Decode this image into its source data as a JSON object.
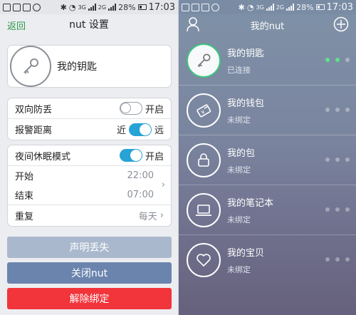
{
  "left": {
    "status": {
      "battery": "28%",
      "time": "17:03",
      "net1": "3G",
      "net2": "2G"
    },
    "header": {
      "back": "返回",
      "title": "nut 设置"
    },
    "key": {
      "name": "我的钥匙",
      "icon": "key-icon"
    },
    "group1": {
      "anti_lost": {
        "label": "双向防丢",
        "state": "开启",
        "on": false
      },
      "alarm_distance": {
        "label": "报警距离",
        "near": "近",
        "far": "远",
        "on": true
      }
    },
    "group2": {
      "night_mode": {
        "label": "夜间休眠模式",
        "state": "开启",
        "on": true
      },
      "start": {
        "label": "开始",
        "value": "22:00"
      },
      "end": {
        "label": "结束",
        "value": "07:00"
      },
      "repeat": {
        "label": "重复",
        "value": "每天"
      }
    },
    "buttons": {
      "declare_lost": {
        "label": "声明丢失",
        "color": "#a9b8cc"
      },
      "close_nut": {
        "label": "关闭nut",
        "color": "#6b84ad"
      },
      "unbind": {
        "label": "解除绑定",
        "color": "#f2343b"
      }
    }
  },
  "right": {
    "status": {
      "battery": "28%",
      "time": "17:03",
      "net1": "3G",
      "net2": "2G"
    },
    "header": {
      "title": "我的nut"
    },
    "devices": [
      {
        "name": "我的钥匙",
        "status": "已连接",
        "icon": "key-icon",
        "dots_on": 2
      },
      {
        "name": "我的钱包",
        "status": "未绑定",
        "icon": "wallet-icon",
        "dots_on": 0
      },
      {
        "name": "我的包",
        "status": "未绑定",
        "icon": "bag-icon",
        "dots_on": 0
      },
      {
        "name": "我的笔记本",
        "status": "未绑定",
        "icon": "laptop-icon",
        "dots_on": 0
      },
      {
        "name": "我的宝贝",
        "status": "未绑定",
        "icon": "heart-icon",
        "dots_on": 0
      }
    ]
  }
}
